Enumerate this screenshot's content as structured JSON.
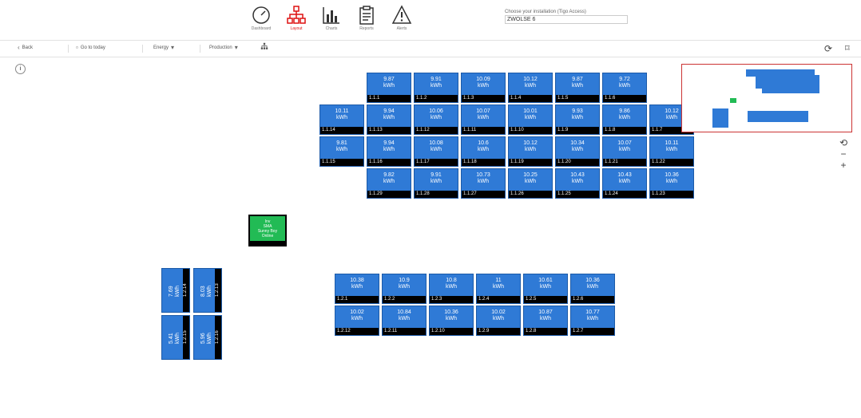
{
  "nav": {
    "items": [
      {
        "label": "Dashboard",
        "icon": "gauge-icon"
      },
      {
        "label": "Layout",
        "icon": "sitemap-icon"
      },
      {
        "label": "Charts",
        "icon": "bar-chart-icon"
      },
      {
        "label": "Reports",
        "icon": "clipboard-icon"
      },
      {
        "label": "Alerts",
        "icon": "warning-icon"
      }
    ],
    "active_color": "#dd1111"
  },
  "system": {
    "label": "Choose your installation (Tigo Access)",
    "value": "ZWOLSE 6"
  },
  "toolbar": {
    "back_label": "Back",
    "history_label": "Go to today",
    "energy_label": "Energy",
    "period_label": "Production",
    "refresh_icon": "refresh-icon",
    "bookmark_icon": "bookmark-icon"
  },
  "panel_unit": "kWh",
  "arrays": {
    "upper": [
      [
        {
          "value": "9.87",
          "id": "1.1.1"
        },
        {
          "value": "9.91",
          "id": "1.1.2"
        },
        {
          "value": "10.09",
          "id": "1.1.3"
        },
        {
          "value": "10.12",
          "id": "1.1.4"
        },
        {
          "value": "9.87",
          "id": "1.1.5"
        },
        {
          "value": "9.72",
          "id": "1.1.6"
        }
      ],
      [
        {
          "value": "10.11",
          "id": "1.1.14"
        },
        {
          "value": "9.94",
          "id": "1.1.13"
        },
        {
          "value": "10.06",
          "id": "1.1.12"
        },
        {
          "value": "10.07",
          "id": "1.1.11"
        },
        {
          "value": "10.01",
          "id": "1.1.10"
        },
        {
          "value": "9.93",
          "id": "1.1.9"
        },
        {
          "value": "9.86",
          "id": "1.1.8"
        },
        {
          "value": "10.12",
          "id": "1.1.7"
        }
      ],
      [
        {
          "value": "9.81",
          "id": "1.1.15"
        },
        {
          "value": "9.94",
          "id": "1.1.16"
        },
        {
          "value": "10.08",
          "id": "1.1.17"
        },
        {
          "value": "10.6",
          "id": "1.1.18"
        },
        {
          "value": "10.12",
          "id": "1.1.19"
        },
        {
          "value": "10.34",
          "id": "1.1.20"
        },
        {
          "value": "10.07",
          "id": "1.1.21"
        },
        {
          "value": "10.11",
          "id": "1.1.22"
        }
      ],
      [
        {
          "value": "9.82",
          "id": "1.1.29"
        },
        {
          "value": "9.91",
          "id": "1.1.28"
        },
        {
          "value": "10.73",
          "id": "1.1.27"
        },
        {
          "value": "10.25",
          "id": "1.1.26"
        },
        {
          "value": "10.43",
          "id": "1.1.25"
        },
        {
          "value": "10.43",
          "id": "1.1.24"
        },
        {
          "value": "10.36",
          "id": "1.1.23"
        }
      ]
    ],
    "lower": [
      [
        {
          "value": "10.38",
          "id": "1.2.1"
        },
        {
          "value": "10.9",
          "id": "1.2.2"
        },
        {
          "value": "10.8",
          "id": "1.2.3"
        },
        {
          "value": "11",
          "id": "1.2.4"
        },
        {
          "value": "10.61",
          "id": "1.2.5"
        },
        {
          "value": "10.36",
          "id": "1.2.6"
        }
      ],
      [
        {
          "value": "10.02",
          "id": "1.2.12"
        },
        {
          "value": "10.84",
          "id": "1.2.11"
        },
        {
          "value": "10.36",
          "id": "1.2.10"
        },
        {
          "value": "10.02",
          "id": "1.2.9"
        },
        {
          "value": "10.87",
          "id": "1.2.8"
        },
        {
          "value": "10.77",
          "id": "1.2.7"
        }
      ]
    ],
    "vertical": [
      {
        "value": "7.69",
        "id": "1.2.14"
      },
      {
        "value": "8.03",
        "id": "1.2.13"
      },
      {
        "value": "5.41",
        "id": "1.2.15"
      },
      {
        "value": "5.96",
        "id": "1.2.16"
      }
    ]
  },
  "inverter": {
    "lines": [
      "Inv",
      "SMA",
      "Sunny Boy",
      "Online"
    ],
    "color": "#22bb55"
  },
  "colors": {
    "panel": "#2f7ad6",
    "minimap_border": "#cc3333"
  },
  "zoom": {
    "reset": "⟲",
    "out": "−",
    "in": "+"
  }
}
